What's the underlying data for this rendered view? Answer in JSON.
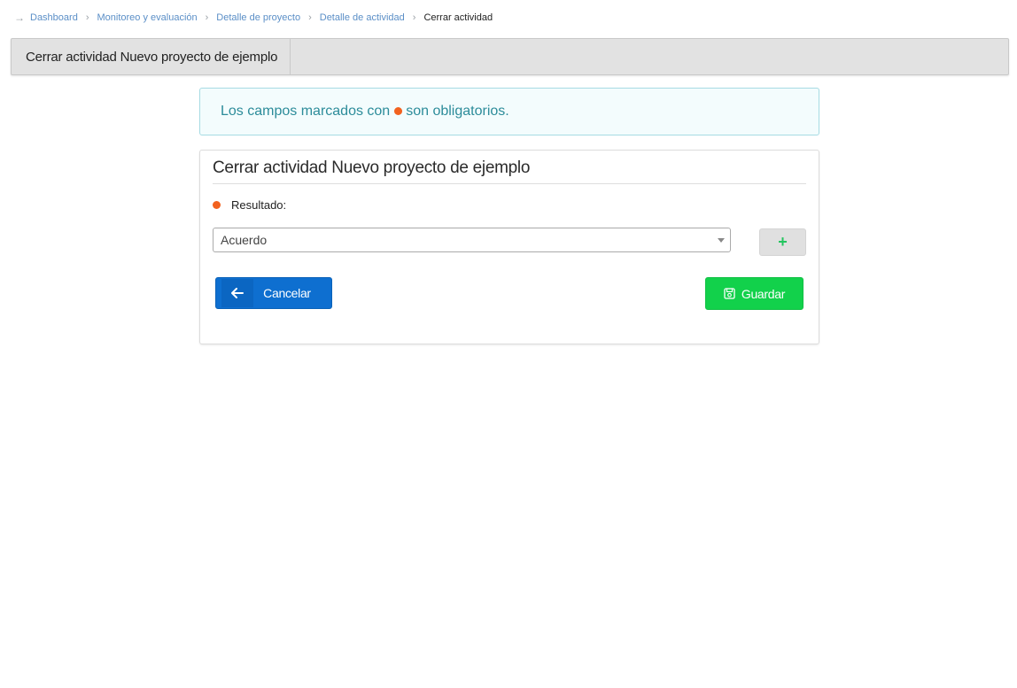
{
  "breadcrumb": {
    "items": [
      "Dashboard",
      "Monitoreo y evaluación",
      "Detalle de proyecto",
      "Detalle de actividad"
    ],
    "current": "Cerrar actividad"
  },
  "header": {
    "title": "Cerrar actividad Nuevo proyecto de ejemplo"
  },
  "alert": {
    "text_before": "Los campos marcados con",
    "text_after": "son obligatorios."
  },
  "form": {
    "title": "Cerrar actividad Nuevo proyecto de ejemplo",
    "result_label": "Resultado:",
    "result_value": "Acuerdo",
    "add_label": "+"
  },
  "actions": {
    "cancel_label": "Cancelar",
    "save_label": "Guardar"
  },
  "colors": {
    "required_dot": "#f2621f",
    "cancel_button": "#0e6fd0",
    "save_button": "#12d14b",
    "alert_text": "#2c8c9a",
    "link": "#5b8fc7"
  },
  "icons": {
    "breadcrumb_start": "arrow-right-icon",
    "separator": "chevron-right-icon",
    "cancel": "arrow-left-icon",
    "save": "floppy-disk-icon",
    "select": "caret-down-icon"
  }
}
